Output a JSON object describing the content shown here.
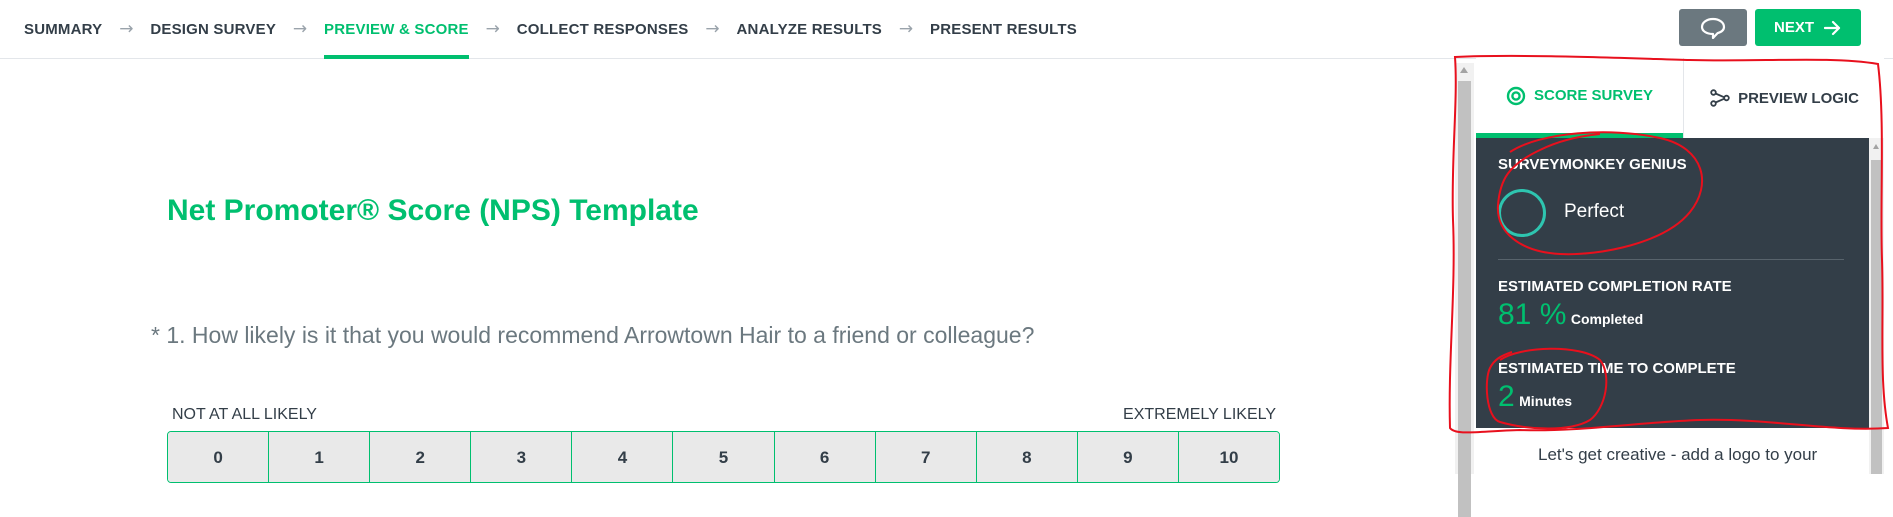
{
  "nav": {
    "steps": [
      {
        "label": "SUMMARY"
      },
      {
        "label": "DESIGN SURVEY"
      },
      {
        "label": "PREVIEW & SCORE"
      },
      {
        "label": "COLLECT RESPONSES"
      },
      {
        "label": "ANALYZE RESULTS"
      },
      {
        "label": "PRESENT RESULTS"
      }
    ],
    "active_step": "PREVIEW & SCORE",
    "next_label": "NEXT",
    "comment_icon": "speech-bubble-icon",
    "next_icon": "arrow-right-icon",
    "step_separator_icon": "arrow-right-icon"
  },
  "survey": {
    "title": "Net Promoter® Score (NPS) Template",
    "question": "* 1. How likely is it that you would recommend Arrowtown Hair to a friend or colleague?",
    "scale_low_label": "NOT AT ALL LIKELY",
    "scale_high_label": "EXTREMELY LIKELY",
    "scale_options": [
      "0",
      "1",
      "2",
      "3",
      "4",
      "5",
      "6",
      "7",
      "8",
      "9",
      "10"
    ]
  },
  "panel": {
    "tabs": [
      {
        "label": "SCORE SURVEY",
        "icon": "target-icon"
      },
      {
        "label": "PREVIEW LOGIC",
        "icon": "branch-icon"
      }
    ],
    "genius_title": "SURVEYMONKEY GENIUS",
    "genius_value": "Perfect",
    "completion_title": "ESTIMATED COMPLETION RATE",
    "completion_value": "81 %",
    "completion_unit": "Completed",
    "time_title": "ESTIMATED TIME TO COMPLETE",
    "time_value": "2",
    "time_unit": "Minutes",
    "tip_text": "Let's get creative - add a logo to your"
  },
  "colors": {
    "accent": "#00bf6f",
    "dark_panel": "#333e48",
    "ring": "#2ec5b0",
    "annotation": "#e8101d"
  }
}
